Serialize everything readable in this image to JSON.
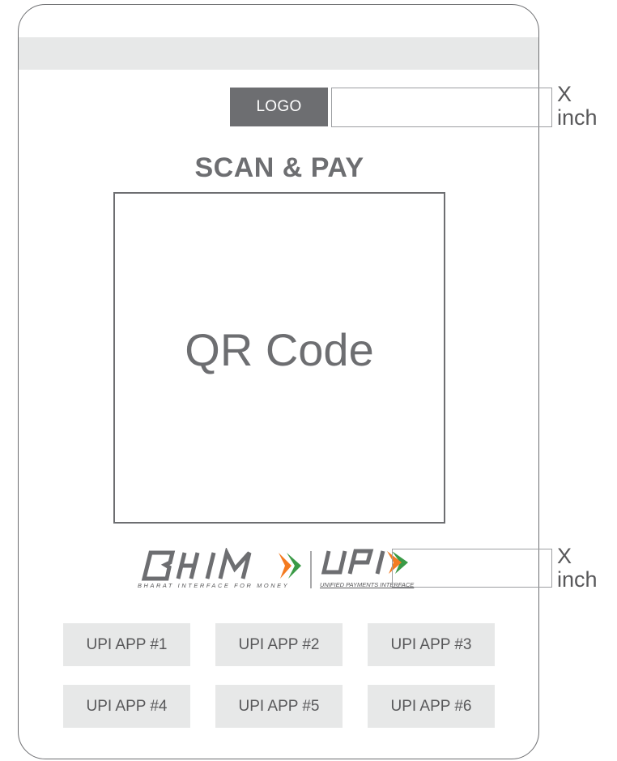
{
  "header": {
    "logo_label": "LOGO"
  },
  "main": {
    "title": "SCAN & PAY",
    "qr_placeholder": "QR Code"
  },
  "brand": {
    "bhim_tagline": "BHARAT INTERFACE FOR MONEY",
    "upi_tagline": "UNIFIED PAYMENTS INTERFACE",
    "colors": {
      "saffron": "#f47b20",
      "green": "#3a9a46",
      "gray": "#6d6e71"
    }
  },
  "dimensions": {
    "logo": {
      "value": "X",
      "unit": "inch"
    },
    "brand": {
      "value": "X",
      "unit": "inch"
    }
  },
  "apps": [
    {
      "label": "UPI APP #1"
    },
    {
      "label": "UPI APP #2"
    },
    {
      "label": "UPI APP #3"
    },
    {
      "label": "UPI APP #4"
    },
    {
      "label": "UPI APP #5"
    },
    {
      "label": "UPI APP #6"
    }
  ]
}
